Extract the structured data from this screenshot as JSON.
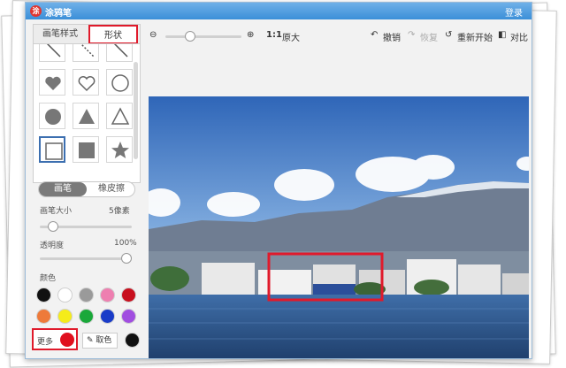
{
  "titlebar": {
    "app_title": "涂鸦笔",
    "login": "登录"
  },
  "tabs": {
    "brush_style": "画笔样式",
    "shape": "形状"
  },
  "shapes": [
    "line-icon",
    "dashed-line-icon",
    "diagonal-line-icon",
    "heart-filled-icon",
    "heart-outline-icon",
    "circle-outline-icon",
    "circle-filled-icon",
    "triangle-filled-icon",
    "triangle-outline-icon",
    "square-outline-icon",
    "square-filled-icon",
    "star-filled-icon"
  ],
  "mode": {
    "brush": "画笔",
    "eraser": "橡皮擦"
  },
  "brush_size": {
    "label": "画笔大小",
    "value_text": "5像素",
    "level": 0.1
  },
  "opacity": {
    "label": "透明度",
    "value_text": "100%",
    "level": 1.0
  },
  "colors": {
    "label": "颜色",
    "row1": [
      "#111111",
      "#ffffff",
      "#9a9a9a",
      "#ee7fb0",
      "#c8101e"
    ],
    "row2": [
      "#ee7a3a",
      "#f5ec1a",
      "#1aa83a",
      "#1a3cc8",
      "#a14ee0"
    ],
    "more": "更多",
    "current": "#e0101e",
    "pick": "取色",
    "picked": "#111111"
  },
  "toolbar": {
    "ratio": "1:1",
    "original": "原大",
    "undo": "撤销",
    "redo": "恢复",
    "restart": "重新开始",
    "compare": "对比",
    "zoom_level": 0.3
  }
}
